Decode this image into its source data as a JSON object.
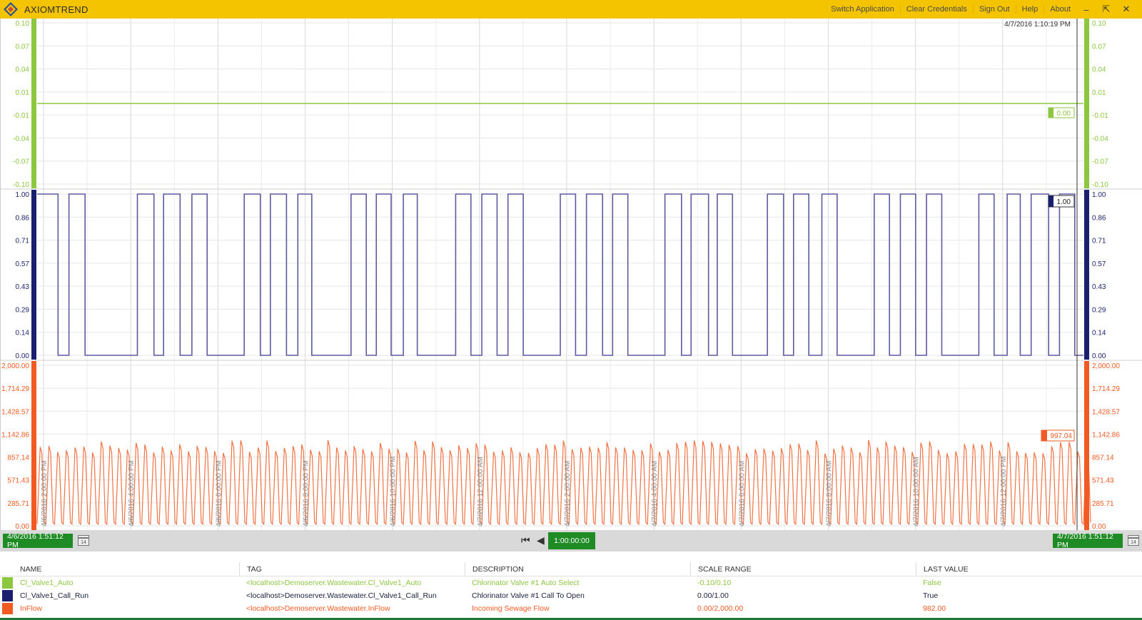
{
  "app": {
    "title": "AXIOMTREND"
  },
  "menu": [
    "Switch Application",
    "Clear Credentials",
    "Sign Out",
    "Help",
    "About"
  ],
  "window_controls": [
    "minimize-icon",
    "restore-icon",
    "close-icon"
  ],
  "cursor_time": "4/7/2016 1:10:19 PM",
  "colors": {
    "auto": "#8dc63f",
    "call": "#1a1f6e",
    "call_line": "#5d5aa0",
    "inflow": "#f15a22",
    "accent": "#f5c400",
    "green": "#1f8b25"
  },
  "chart_data": {
    "type": "line",
    "x_tick_labels": [
      "4/6/2016 2:00:00 PM",
      "4/6/2016 4:00:00 PM",
      "4/6/2016 6:00:00 PM",
      "4/6/2016 8:00:00 PM",
      "4/6/2016 10:00:00 PM",
      "4/7/2016 12:00:00 AM",
      "4/7/2016 2:00:00 AM",
      "4/7/2016 4:00:00 AM",
      "4/7/2016 6:00:00 AM",
      "4/7/2016 8:00:00 AM",
      "4/7/2016 10:00:00 AM",
      "4/7/2016 12:00:00 PM"
    ],
    "x_range": [
      "4/6/2016 1:51:12 PM",
      "4/7/2016 1:51:12 PM"
    ],
    "grid": true,
    "panes": [
      {
        "name": "Cl_Valve1_Auto",
        "ylim": [
          -0.1,
          0.1
        ],
        "ticks": [
          "0.10",
          "0.07",
          "0.04",
          "0.01",
          "-0.01",
          "-0.04",
          "-0.07",
          "-0.10"
        ],
        "value": 0,
        "marker": "0.00"
      },
      {
        "name": "Cl_Valve1_Call_Run",
        "ylim": [
          0,
          1
        ],
        "ticks": [
          "1.00",
          "0.86",
          "0.71",
          "0.57",
          "0.43",
          "0.29",
          "0.14",
          "0.00"
        ],
        "high_intervals_hours": [
          [
            0,
            0.48
          ],
          [
            0.73,
            1.1
          ],
          [
            2.3,
            2.68
          ],
          [
            2.9,
            3.28
          ],
          [
            3.55,
            3.9
          ],
          [
            4.75,
            5.12
          ],
          [
            5.35,
            5.72
          ],
          [
            5.98,
            6.3
          ],
          [
            7.2,
            7.55
          ],
          [
            7.78,
            8.12
          ],
          [
            8.4,
            8.72
          ],
          [
            9.6,
            9.95
          ],
          [
            10.2,
            10.55
          ],
          [
            10.8,
            11.15
          ],
          [
            12.0,
            12.35
          ],
          [
            12.6,
            12.97
          ],
          [
            13.2,
            13.55
          ],
          [
            14.4,
            14.78
          ],
          [
            15.0,
            15.4
          ],
          [
            15.6,
            15.95
          ],
          [
            16.75,
            17.12
          ],
          [
            17.35,
            17.7
          ],
          [
            18.0,
            18.35
          ],
          [
            19.2,
            19.55
          ],
          [
            19.8,
            20.15
          ],
          [
            20.4,
            20.75
          ],
          [
            21.6,
            21.95
          ],
          [
            22.25,
            22.55
          ],
          [
            22.8,
            23.2
          ],
          [
            23.45,
            23.8
          ]
        ],
        "marker": "1.00"
      },
      {
        "name": "InFlow",
        "ylim": [
          0,
          2000
        ],
        "ticks": [
          "2,000.00",
          "1,714.29",
          "1,428.57",
          "1,142.86",
          "857.14",
          "571.43",
          "285.71",
          "0.00"
        ],
        "cycle_hours": 0.2,
        "peak_range": [
          900,
          1070
        ],
        "marker": "997.04"
      }
    ]
  },
  "bottom": {
    "start": "4/6/2016 1:51:12 PM",
    "span": "1:00:00:00",
    "end": "4/7/2016 1:51:12 PM",
    "calendar_day": "14"
  },
  "legend": {
    "headers": [
      "NAME",
      "TAG",
      "DESCRIPTION",
      "SCALE RANGE",
      "LAST VALUE"
    ],
    "rows": [
      {
        "name": "Cl_Valve1_Auto",
        "tag": "<localhost>Demoserver.Wastewater.Cl_Valve1_Auto",
        "description": "Chlorinator Valve #1 Auto Select",
        "scale": "-0.10/0.10",
        "last": "False",
        "color": "#8dc63f"
      },
      {
        "name": "Cl_Valve1_Call_Run",
        "tag": "<localhost>Demoserver.Wastewater.Cl_Valve1_Call_Run",
        "description": "Chlorinator Valve #1 Call To Open",
        "scale": "0.00/1.00",
        "last": "True",
        "color": "#1a1f6e"
      },
      {
        "name": "InFlow",
        "tag": "<localhost>Demoserver.Wastewater.InFlow",
        "description": "Incoming Sewage Flow",
        "scale": "0.00/2,000.00",
        "last": "982.00",
        "color": "#f15a22"
      }
    ]
  }
}
